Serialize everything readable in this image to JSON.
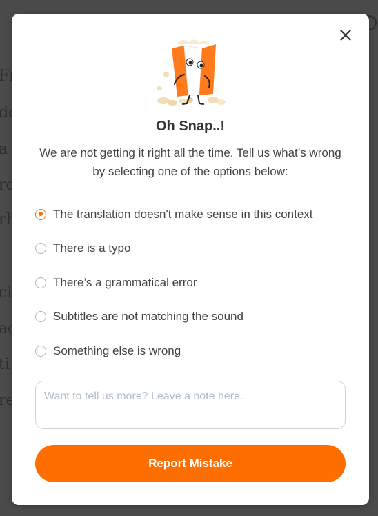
{
  "background": {
    "fragments": [
      "Fr",
      "do",
      "a r",
      "ro",
      "rh",
      "ci",
      "ac",
      "ti",
      "re"
    ]
  },
  "modal": {
    "close_icon": "close-icon",
    "mascot_icon": "mascot-illustration",
    "title": "Oh Snap..!",
    "subtitle": "We are not getting it right all the time. Tell us what’s wrong by selecting one of the options below:",
    "options": [
      {
        "label": "The translation doesn't make sense in this context",
        "selected": true
      },
      {
        "label": "There is a typo",
        "selected": false
      },
      {
        "label": "There’s a grammatical error",
        "selected": false
      },
      {
        "label": "Subtitles are not matching the sound",
        "selected": false
      },
      {
        "label": "Something else is wrong",
        "selected": false
      }
    ],
    "note_placeholder": "Want to tell us more? Leave a note here.",
    "note_value": "",
    "submit_label": "Report Mistake"
  },
  "colors": {
    "accent": "#ff6e00",
    "overlay": "#4b4b4b",
    "text": "#444444",
    "placeholder": "#b3bcc8"
  }
}
